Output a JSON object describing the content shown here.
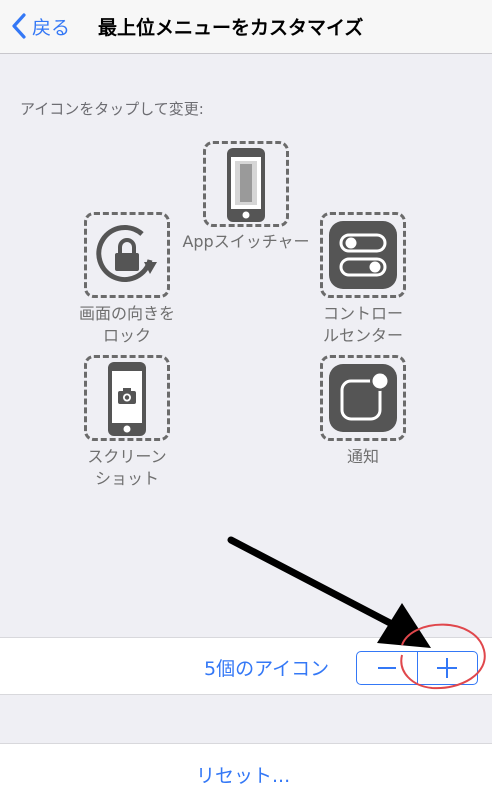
{
  "nav": {
    "back_label": "戻る",
    "title": "最上位メニューをカスタマイズ"
  },
  "instruction": "アイコンをタップして変更:",
  "icons": [
    {
      "label": "Appスイッチャー",
      "icon": "app-switcher-icon"
    },
    {
      "label_lines": [
        "画面の向きを",
        "ロック"
      ],
      "icon": "rotation-lock-icon"
    },
    {
      "label_lines": [
        "コントロー",
        "ルセンター"
      ],
      "icon": "control-center-icon"
    },
    {
      "label_lines": [
        "スクリーン",
        "ショット"
      ],
      "icon": "screenshot-icon"
    },
    {
      "label": "通知",
      "icon": "notification-icon"
    }
  ],
  "count_label": "5個のアイコン",
  "stepper": {
    "minus_label": "−",
    "plus_label": "+"
  },
  "reset_label": "リセット...",
  "colors": {
    "accent": "#3478f6",
    "background": "#efeff4",
    "icon_dark": "#555555",
    "label_gray": "#6f6f6f",
    "annotation_red": "#e0474c",
    "annotation_arrow": "#000000"
  }
}
